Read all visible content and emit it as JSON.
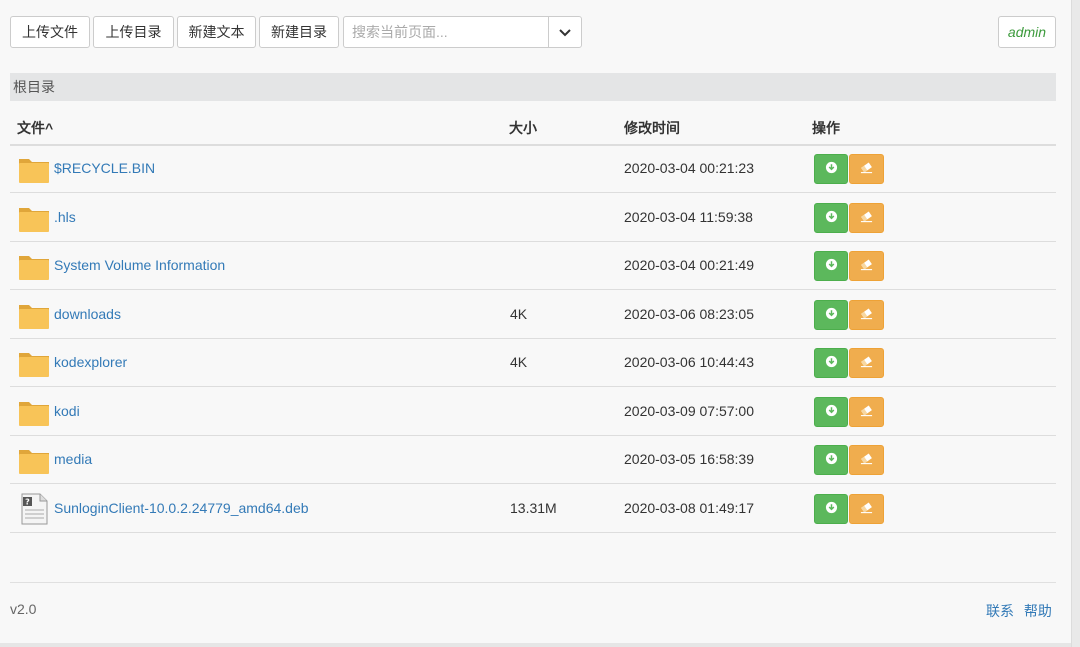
{
  "toolbar": {
    "upload_file": "上传文件",
    "upload_dir": "上传目录",
    "new_text": "新建文本",
    "new_dir": "新建目录",
    "search_placeholder": "搜索当前页面...",
    "user": "admin"
  },
  "breadcrumb": {
    "root": "根目录"
  },
  "table": {
    "headers": {
      "file": "文件",
      "sort_indicator": "^",
      "size": "大小",
      "modified": "修改时间",
      "actions": "操作"
    },
    "rows": [
      {
        "name": "$RECYCLE.BIN",
        "size": "",
        "modified": "2020-03-04 00:21:23",
        "type": "folder"
      },
      {
        "name": ".hls",
        "size": "",
        "modified": "2020-03-04 11:59:38",
        "type": "folder"
      },
      {
        "name": "System Volume Information",
        "size": "",
        "modified": "2020-03-04 00:21:49",
        "type": "folder"
      },
      {
        "name": "downloads",
        "size": "4K",
        "modified": "2020-03-06 08:23:05",
        "type": "folder"
      },
      {
        "name": "kodexplorer",
        "size": "4K",
        "modified": "2020-03-06 10:44:43",
        "type": "folder"
      },
      {
        "name": "kodi",
        "size": "",
        "modified": "2020-03-09 07:57:00",
        "type": "folder"
      },
      {
        "name": "media",
        "size": "",
        "modified": "2020-03-05 16:58:39",
        "type": "folder"
      },
      {
        "name": "SunloginClient-10.0.2.24779_amd64.deb",
        "size": "13.31M",
        "modified": "2020-03-08 01:49:17",
        "type": "file"
      }
    ]
  },
  "footer": {
    "version": "v2.0",
    "contact": "联系",
    "help": "帮助"
  },
  "colors": {
    "link": "#337ab7",
    "download": "#5cb85c",
    "edit": "#f0ad4e",
    "folder": "#f8c458",
    "admin": "#3c9a3c"
  },
  "icons": {
    "folder": "folder-icon",
    "file": "file-icon",
    "download": "download-icon",
    "edit": "eraser-icon",
    "dropdown": "chevron-down-icon"
  }
}
